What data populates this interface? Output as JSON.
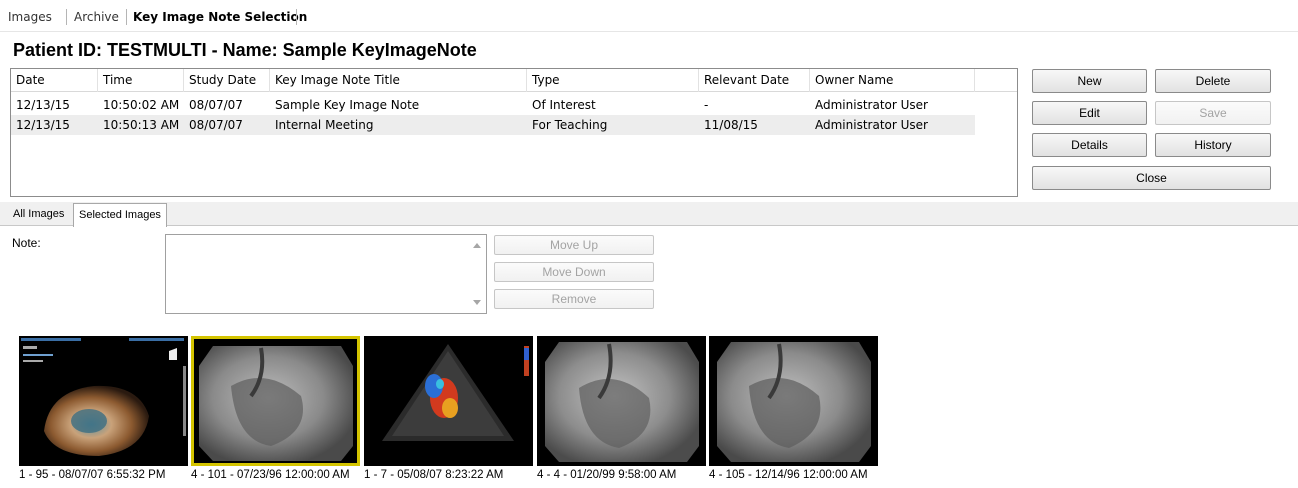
{
  "top_tabs": [
    "Images",
    "Archive",
    "Key Image Note Selection"
  ],
  "patient_title": "Patient ID: TESTMULTI - Name: Sample KeyImageNote",
  "table": {
    "columns": [
      "Date",
      "Time",
      "Study Date",
      "Key Image Note Title",
      "Type",
      "Relevant Date",
      "Owner Name"
    ],
    "rows": [
      [
        "12/13/15",
        "10:50:02 AM",
        "08/07/07",
        "Sample Key Image Note",
        "Of Interest",
        "-",
        "Administrator User"
      ],
      [
        "12/13/15",
        "10:50:13 AM",
        "08/07/07",
        "Internal Meeting",
        "For Teaching",
        "11/08/15",
        "Administrator User"
      ]
    ]
  },
  "buttons": {
    "new": "New",
    "delete": "Delete",
    "edit": "Edit",
    "save": "Save",
    "details": "Details",
    "history": "History",
    "close": "Close"
  },
  "image_tabs": [
    "All Images",
    "Selected Images"
  ],
  "note": {
    "label": "Note:",
    "value": ""
  },
  "move_buttons": {
    "up": "Move Up",
    "down": "Move Down",
    "remove": "Remove"
  },
  "thumbnails": [
    {
      "caption": "1 - 95 - 08/07/07 6:55:32 PM",
      "kind": "3d-echo",
      "selected": false
    },
    {
      "caption": "4 - 101 - 07/23/96 12:00:00 AM",
      "kind": "xray",
      "selected": true
    },
    {
      "caption": "1 - 7 - 05/08/07 8:23:22 AM",
      "kind": "doppler",
      "selected": false
    },
    {
      "caption": "4 - 4 - 01/20/99 9:58:00 AM",
      "kind": "xray",
      "selected": false
    },
    {
      "caption": "4 - 105 - 12/14/96 12:00:00 AM",
      "kind": "xray",
      "selected": false
    }
  ],
  "colors": {
    "selection_outline": "#d4c400",
    "row_alt": "#ededed"
  }
}
